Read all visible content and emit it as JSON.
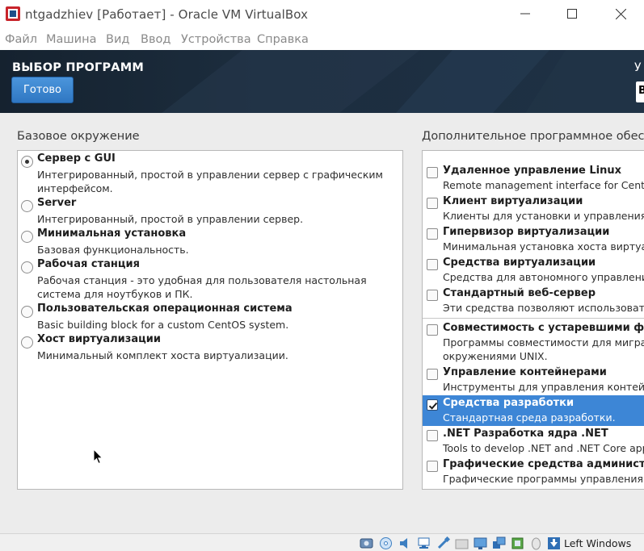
{
  "window": {
    "title": "ntgadzhiev [Работает] - Oracle VM VirtualBox",
    "minimize_glyph": "—",
    "maximize_glyph": "☐",
    "close_glyph": "✕"
  },
  "menu": {
    "items": [
      "Файл",
      "Машина",
      "Вид",
      "Ввод",
      "Устройства",
      "Справка"
    ]
  },
  "installer": {
    "spoke_title": "ВЫБОР ПРОГРАММ",
    "done_button": "Готово",
    "right_header_fragment": "У",
    "lang_fragment": "В",
    "base_env_label": "Базовое окружение",
    "addons_label": "Дополнительное программное обеспече"
  },
  "base_environments": [
    {
      "title": "Сервер с GUI",
      "desc": "Интегрированный, простой в управлении сервер с графическим интерфейсом.",
      "selected": true
    },
    {
      "title": "Server",
      "desc": "Интегрированный, простой в управлении сервер.",
      "selected": false
    },
    {
      "title": "Минимальная установка",
      "desc": "Базовая функциональность.",
      "selected": false
    },
    {
      "title": "Рабочая станция",
      "desc": "Рабочая станция - это удобная для пользователя настольная система для ноутбуков и ПК.",
      "selected": false
    },
    {
      "title": "Пользовательская операционная система",
      "desc": "Basic building block for a custom CentOS system.",
      "selected": false
    },
    {
      "title": "Хост виртуализации",
      "desc": "Минимальный комплект хоста виртуализации.",
      "selected": false
    }
  ],
  "addons": [
    {
      "title": "Удаленное управление Linux",
      "desc": "Remote management interface for CentOS",
      "checked": false
    },
    {
      "title": "Клиент виртуализации",
      "desc": "Клиенты для установки и управления экзе",
      "checked": false
    },
    {
      "title": "Гипервизор виртуализации",
      "desc": "Минимальная установка хоста виртуализа",
      "checked": false
    },
    {
      "title": "Средства виртуализации",
      "desc": "Средства для автономного управления ви",
      "checked": false
    },
    {
      "title": "Стандартный веб-сервер",
      "desc": "Эти средства позволяют использовать си",
      "checked": false
    },
    {
      "title": "Совместимость с устаревшими функци",
      "desc": "Программы совместимости для миграции",
      "desc2": "окружениями UNIX.",
      "checked": false
    },
    {
      "title": "Управление контейнерами",
      "desc": "Инструменты для управления контейнера",
      "checked": false
    },
    {
      "title": "Средства разработки",
      "desc": "Стандартная среда разработки.",
      "checked": true
    },
    {
      "title": ".NET Разработка ядра .NET",
      "desc": "Tools to develop .NET and .NET Core appli",
      "checked": false
    },
    {
      "title": "Графические средства администриров",
      "desc": "Графические программы управления сис",
      "checked": false
    }
  ],
  "statusbar": {
    "host_key": "Left Windows",
    "icons": [
      "hard-disk-icon",
      "optical-drive-icon",
      "audio-icon",
      "network-icon",
      "usb-icon",
      "shared-folders-icon",
      "display-icon",
      "recording-icon",
      "cpu-virtualization-icon",
      "mouse-integration-icon",
      "host-key-arrow-icon"
    ]
  },
  "colors": {
    "selection": "#3d86d6",
    "done_button": "#3a85d0",
    "banner": "#1c2d3e"
  }
}
